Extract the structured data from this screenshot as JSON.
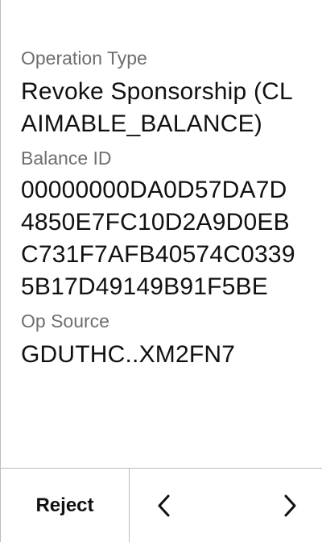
{
  "operation_type": {
    "label": "Operation Type",
    "value": "Revoke Sponsorship (CLAIMABLE_BALANCE)"
  },
  "balance_id": {
    "label": "Balance ID",
    "value": "00000000DA0D57DA7D4850E7FC10D2A9D0EBC731F7AFB40574C03395B17D49149B91F5BE"
  },
  "op_source": {
    "label": "Op Source",
    "value": "GDUTHC..XM2FN7"
  },
  "footer": {
    "reject_label": "Reject",
    "prev_icon": "chevron-left-icon",
    "next_icon": "chevron-right-icon"
  }
}
